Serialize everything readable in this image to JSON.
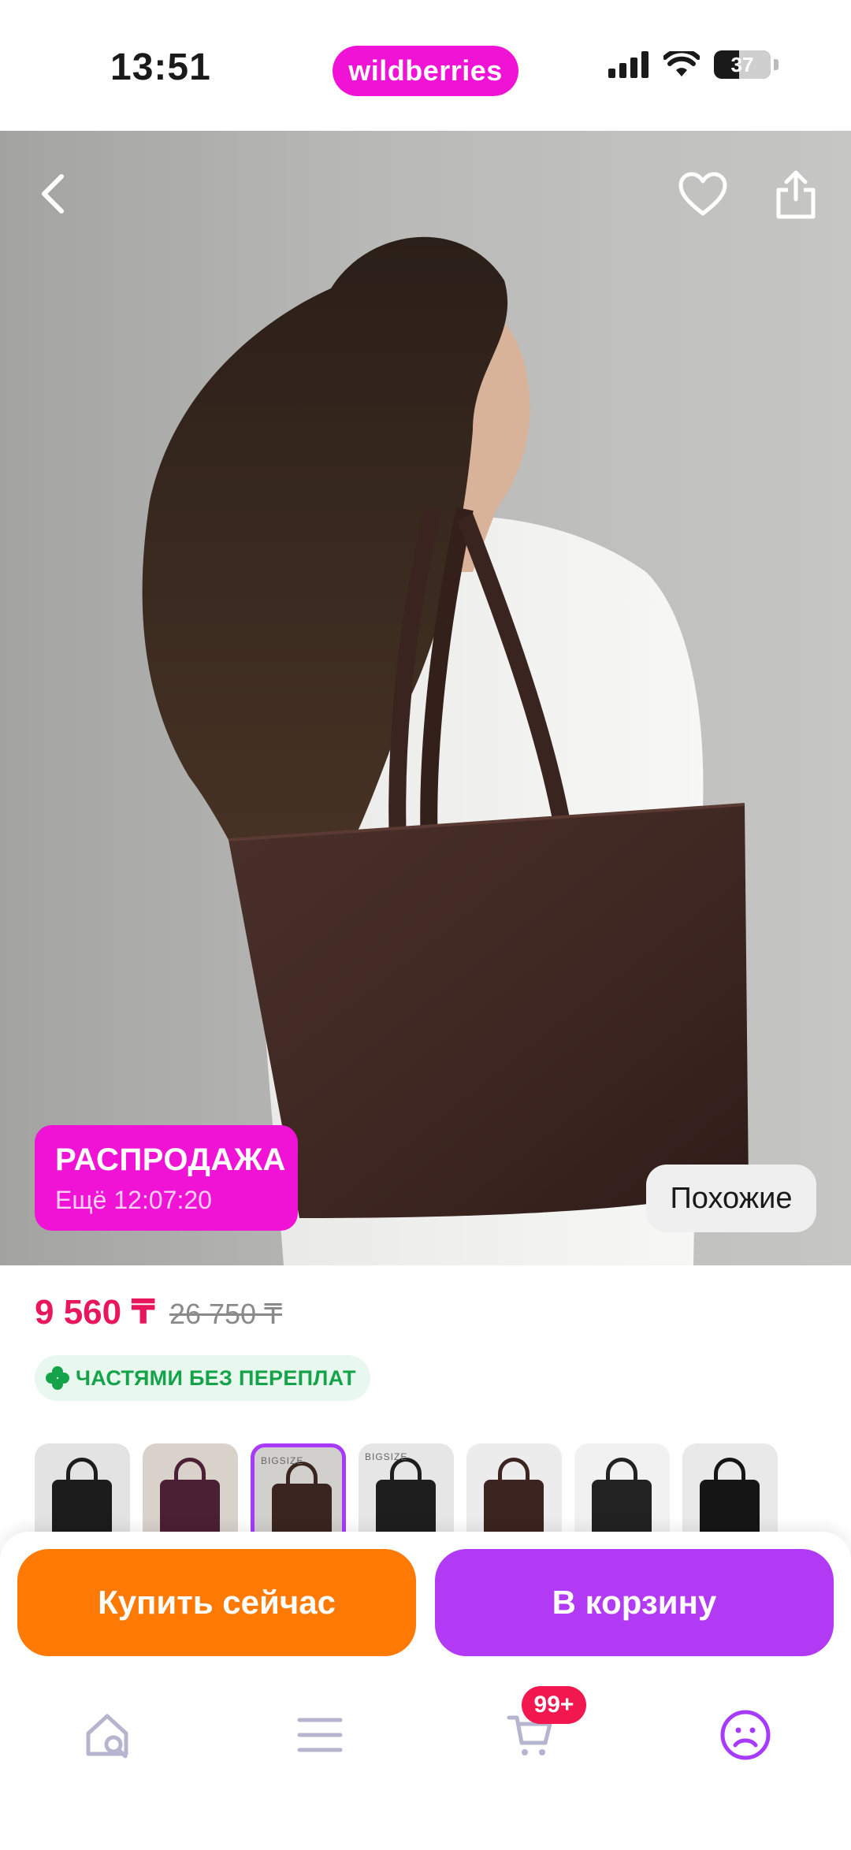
{
  "status_bar": {
    "time": "13:51",
    "brand": "wildberries",
    "battery": "37",
    "icons": [
      "signal-icon",
      "wifi-icon",
      "battery-icon"
    ]
  },
  "hero": {
    "icons": [
      "back-arrow-icon",
      "heart-icon",
      "share-icon"
    ],
    "sale_badge": {
      "title": "РАСПРОДАЖА",
      "timer": "Ещё 12:07:20"
    },
    "similar_label": "Похожие"
  },
  "price": {
    "current": "9 560 ₸",
    "old": "26 750 ₸"
  },
  "installments": {
    "icon": "clover-icon",
    "label": "ЧАСТЯМИ БЕЗ ПЕРЕПЛАТ"
  },
  "thumbnails": [
    {
      "name": "thumb-1",
      "bag": "#1c1c1c",
      "bg": "#e3e3e3",
      "caption": ""
    },
    {
      "name": "thumb-2",
      "bag": "#4b1f34",
      "bg": "#d9d2cb",
      "caption": ""
    },
    {
      "name": "thumb-3",
      "bag": "#3a2520",
      "bg": "#d2d0cc",
      "caption": "BIGSIZE",
      "active": true
    },
    {
      "name": "thumb-4",
      "bag": "#1e1e1e",
      "bg": "#e6e6e6",
      "caption": "BIGSIZE"
    },
    {
      "name": "thumb-5",
      "bag": "#3c2420",
      "bg": "#ececec",
      "caption": ""
    },
    {
      "name": "thumb-6",
      "bag": "#222222",
      "bg": "#f1f1f1",
      "caption": ""
    },
    {
      "name": "thumb-7",
      "bag": "#151515",
      "bg": "#e9e9e9",
      "caption": ""
    }
  ],
  "actions": {
    "buy_now": "Купить сейчас",
    "add_to_cart": "В корзину"
  },
  "tabbar": {
    "cart_badge": "99+",
    "tabs": [
      "home-search-icon",
      "catalog-menu-icon",
      "cart-icon",
      "profile-icon"
    ],
    "active_color": "#a73afd"
  },
  "colors": {
    "brand_pink": "#f013d6",
    "price_red": "#e8175d",
    "buy_orange": "#ff7a05",
    "cart_purple": "#b23af4",
    "installments_green": "#15a34a"
  }
}
